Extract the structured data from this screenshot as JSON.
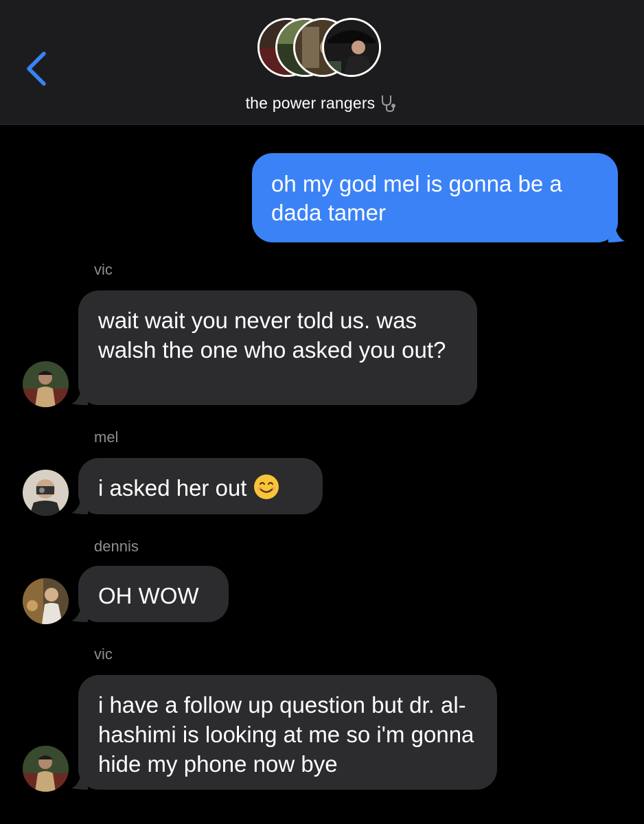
{
  "header": {
    "back_icon": "chevron-left-icon",
    "group_name": "the power rangers",
    "group_emoji": "stethoscope-icon",
    "accent_color": "#3b82f6"
  },
  "messages": [
    {
      "direction": "outgoing",
      "text": "oh my god mel is gonna be a dada tamer"
    },
    {
      "direction": "incoming",
      "sender": "vic",
      "text": "wait wait you never told us. was walsh the one who asked you out?"
    },
    {
      "direction": "incoming",
      "sender": "mel",
      "text": "i asked her out",
      "emoji": "smiling-face-icon"
    },
    {
      "direction": "incoming",
      "sender": "dennis",
      "text": "OH WOW"
    },
    {
      "direction": "incoming",
      "sender": "vic",
      "text": "i have a follow up question but dr. al-hashimi is looking at me so i'm gonna hide my phone now bye"
    }
  ],
  "colors": {
    "outgoing_bubble": "#3b82f6",
    "incoming_bubble": "#2c2c2e",
    "header_bg": "#1c1c1e",
    "sender_label": "#8e8e93"
  }
}
